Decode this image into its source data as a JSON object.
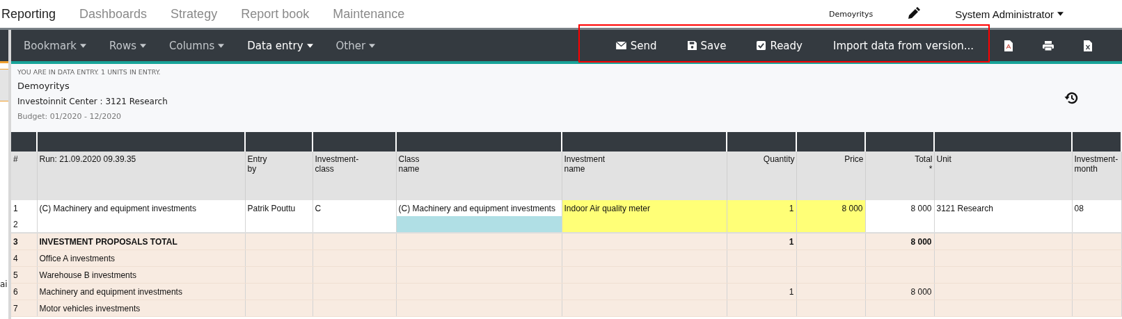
{
  "top_nav": {
    "tabs": [
      {
        "label": "Reporting",
        "selected": true
      },
      {
        "label": "Dashboards",
        "selected": false
      },
      {
        "label": "Strategy",
        "selected": false
      },
      {
        "label": "Report book",
        "selected": false
      },
      {
        "label": "Maintenance",
        "selected": false
      }
    ],
    "workspace": "Demoyritys",
    "user": "System Administrator"
  },
  "left_strip": {
    "text": "ai"
  },
  "toolbar": {
    "menus": [
      {
        "label": "Bookmark",
        "selected": false
      },
      {
        "label": "Rows",
        "selected": false
      },
      {
        "label": "Columns",
        "selected": false
      },
      {
        "label": "Data entry",
        "selected": true
      },
      {
        "label": "Other",
        "selected": false
      }
    ],
    "actions": [
      {
        "label": "Send",
        "kind": "send"
      },
      {
        "label": "Save",
        "kind": "save"
      },
      {
        "label": "Ready",
        "kind": "ready"
      },
      {
        "label": "Import data from version...",
        "kind": "import"
      }
    ],
    "exports": [
      {
        "kind": "pdf"
      },
      {
        "kind": "print"
      },
      {
        "kind": "excel"
      }
    ],
    "highlighted": true
  },
  "info": {
    "notice": "YOU ARE IN DATA ENTRY. 1 UNITS IN ENTRY.",
    "company": "Demoyritys",
    "unit": "Investoinnit Center : 3121 Research",
    "period": "Budget: 01/2020 - 12/2020"
  },
  "table": {
    "columns": [
      {
        "lines": [
          "#"
        ],
        "numeric": false
      },
      {
        "lines": [
          "Run: 21.09.2020 09.39.35"
        ],
        "numeric": false
      },
      {
        "lines": [
          "Entry",
          "by"
        ],
        "numeric": false
      },
      {
        "lines": [
          "Investment-",
          "class"
        ],
        "numeric": false
      },
      {
        "lines": [
          "Class",
          "name"
        ],
        "numeric": false
      },
      {
        "lines": [
          "Investment",
          "name"
        ],
        "numeric": false
      },
      {
        "lines": [
          "Quantity"
        ],
        "numeric": true
      },
      {
        "lines": [
          "Price"
        ],
        "numeric": true
      },
      {
        "lines": [
          "Total",
          "*"
        ],
        "numeric": true
      },
      {
        "lines": [
          "Unit"
        ],
        "numeric": false
      },
      {
        "lines": [
          "Investment-",
          "month"
        ],
        "numeric": false
      }
    ],
    "rows": [
      {
        "kind": "entry",
        "bold": false,
        "cells": [
          {
            "text": "1"
          },
          {
            "text": "(C) Machinery and equipment investments",
            "editable": false,
            "selected": false
          },
          {
            "text": "Patrik Pouttu",
            "editable": false,
            "selected": false
          },
          {
            "text": "C",
            "editable": false,
            "selected": false
          },
          {
            "text": "(C) Machinery and equipment investments",
            "editable": false,
            "selected": false
          },
          {
            "text": "Indoor Air quality meter",
            "editable": true,
            "selected": false
          },
          {
            "text": "1",
            "editable": true,
            "selected": false
          },
          {
            "text": "8 000",
            "editable": true,
            "selected": false
          },
          {
            "text": "8 000",
            "editable": false,
            "selected": false
          },
          {
            "text": "3121 Research",
            "editable": false,
            "selected": false
          },
          {
            "text": "08",
            "editable": false,
            "selected": false
          }
        ]
      },
      {
        "kind": "entry",
        "bold": false,
        "cells": [
          {
            "text": "2"
          },
          {
            "editable": false,
            "selected": false
          },
          {
            "editable": false,
            "selected": false
          },
          {
            "editable": false,
            "selected": false
          },
          {
            "editable": false,
            "selected": true
          },
          {
            "editable": true,
            "selected": false
          },
          {
            "editable": true,
            "selected": false
          },
          {
            "editable": true,
            "selected": false
          },
          {
            "editable": false,
            "selected": false
          },
          {
            "editable": false,
            "selected": false
          },
          {
            "editable": false,
            "selected": false
          }
        ]
      },
      {
        "kind": "summary",
        "bold": true,
        "cells": [
          {
            "text": "3"
          },
          {
            "text": "INVESTMENT PROPOSALS TOTAL"
          },
          {},
          {},
          {},
          {},
          {
            "text": "1"
          },
          {},
          {
            "text": "8 000"
          },
          {},
          {}
        ]
      },
      {
        "kind": "summary",
        "bold": false,
        "cells": [
          {
            "text": "4"
          },
          {
            "text": "Office A investments"
          },
          {},
          {},
          {},
          {},
          {},
          {},
          {},
          {},
          {}
        ]
      },
      {
        "kind": "summary",
        "bold": false,
        "cells": [
          {
            "text": "5"
          },
          {
            "text": "Warehouse B investments"
          },
          {},
          {},
          {},
          {},
          {},
          {},
          {},
          {},
          {}
        ]
      },
      {
        "kind": "summary",
        "bold": false,
        "cells": [
          {
            "text": "6"
          },
          {
            "text": "Machinery and equipment investments"
          },
          {},
          {},
          {},
          {},
          {
            "text": "1"
          },
          {},
          {
            "text": "8 000"
          },
          {},
          {}
        ]
      },
      {
        "kind": "summary",
        "bold": false,
        "cells": [
          {
            "text": "7"
          },
          {
            "text": "Motor vehicles investments"
          },
          {},
          {},
          {},
          {},
          {},
          {},
          {},
          {},
          {}
        ]
      }
    ]
  }
}
